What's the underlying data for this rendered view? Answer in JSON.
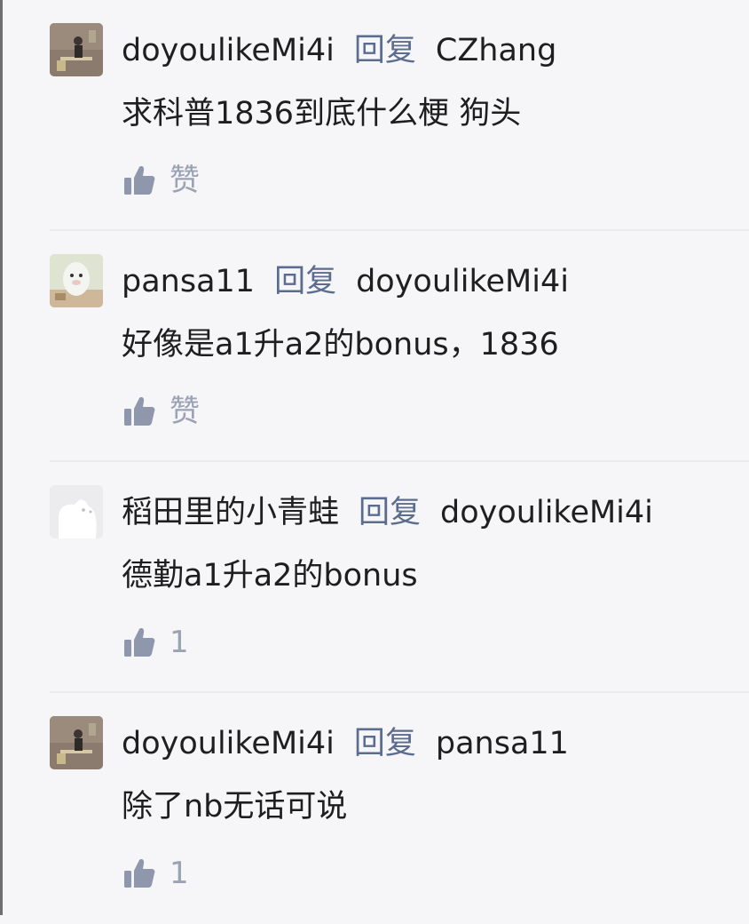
{
  "comments": [
    {
      "username": "doyoulikeMi4i",
      "reply_word": "回复",
      "reply_to": "CZhang",
      "text": "求科普1836到底什么梗 狗头",
      "like_label": "赞",
      "avatar_icon": "figure-avatar"
    },
    {
      "username": "pansa11",
      "reply_word": "回复",
      "reply_to": "doyoulikeMi4i",
      "text": "好像是a1升a2的bonus，1836",
      "like_label": "赞",
      "avatar_icon": "cartoon-avatar"
    },
    {
      "username": "稻田里的小青蛙",
      "reply_word": "回复",
      "reply_to": "doyoulikeMi4i",
      "text": "德勤a1升a2的bonus",
      "like_label": "1",
      "avatar_icon": "dog-avatar"
    },
    {
      "username": "doyoulikeMi4i",
      "reply_word": "回复",
      "reply_to": "pansa11",
      "text": "除了nb无话可说",
      "like_label": "1",
      "avatar_icon": "figure-avatar"
    }
  ],
  "colors": {
    "background": "#f6f6f8",
    "reply_word": "#5b6d8f",
    "like": "#8e97ab"
  }
}
